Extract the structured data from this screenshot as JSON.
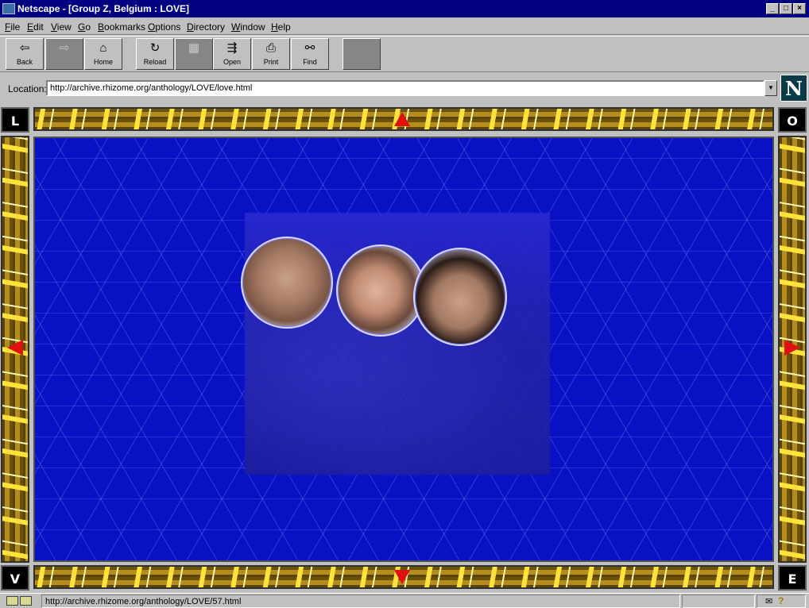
{
  "window": {
    "title": "Netscape - [Group Z, Belgium : LOVE]",
    "controls": [
      "_",
      "□",
      "×"
    ]
  },
  "menu": [
    {
      "label": "File",
      "key": "F",
      "rest": "ile"
    },
    {
      "label": "Edit",
      "key": "E",
      "rest": "dit"
    },
    {
      "label": "View",
      "key": "V",
      "rest": "iew"
    },
    {
      "label": "Go",
      "key": "G",
      "rest": "o"
    },
    {
      "label": "Bookmarks",
      "key": "B",
      "rest": "ookmarks"
    },
    {
      "label": "Options",
      "key": "O",
      "rest": "ptions"
    },
    {
      "label": "Directory",
      "key": "D",
      "rest": "irectory"
    },
    {
      "label": "Window",
      "key": "W",
      "rest": "indow"
    },
    {
      "label": "Help",
      "key": "H",
      "rest": "elp"
    }
  ],
  "toolbar": {
    "back": {
      "label": "Back",
      "icon": "back-arrow-icon"
    },
    "forward": {
      "label": "",
      "icon": "forward-arrow-icon"
    },
    "home": {
      "label": "Home",
      "icon": "house-icon"
    },
    "reload": {
      "label": "Reload",
      "icon": "reload-icon"
    },
    "images": {
      "label": "",
      "icon": "images-icon"
    },
    "open": {
      "label": "Open",
      "icon": "open-icon"
    },
    "print": {
      "label": "Print",
      "icon": "printer-icon"
    },
    "find": {
      "label": "Find",
      "icon": "binoculars-icon"
    },
    "stop": {
      "label": "",
      "icon": "stop-icon"
    }
  },
  "location": {
    "label": "Location:",
    "url": "http://archive.rhizome.org/anthology/LOVE/love.html",
    "logo_letter": "N"
  },
  "frame": {
    "corners": {
      "top_left": "L",
      "top_right": "O",
      "bottom_left": "V",
      "bottom_right": "E"
    },
    "arrow_color": "#e01010",
    "stage_color": "#0a10c4"
  },
  "status": {
    "text": "http://archive.rhizome.org/anthology/LOVE/57.html",
    "mail_icon": "✉",
    "help_icon": "?"
  },
  "colors": {
    "titlebar": "#000080",
    "chrome": "#c0c0c0",
    "gold": "#e0b520"
  }
}
